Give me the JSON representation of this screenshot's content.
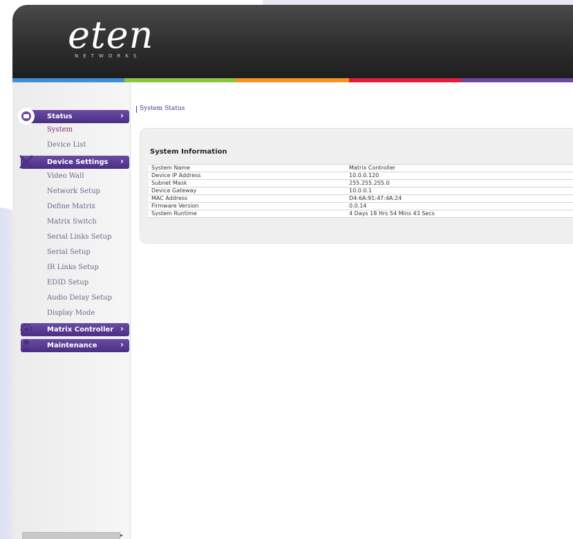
{
  "brand": {
    "logo_text": "eten",
    "logo_sub": "NETWORKS"
  },
  "colorbar": [
    "#3c8fd6",
    "#8dc63f",
    "#f7941d",
    "#e31b3c",
    "#6a4ba3"
  ],
  "sidebar": {
    "sections": [
      {
        "label": "Status",
        "icon": "status-icon",
        "items": [
          {
            "label": "System",
            "active": true
          },
          {
            "label": "Device List",
            "active": false
          }
        ]
      },
      {
        "label": "Device Settings",
        "icon": "tools-icon",
        "items": [
          {
            "label": "Video Wall"
          },
          {
            "label": "Network Setup"
          },
          {
            "label": "Define Matrix"
          },
          {
            "label": "Matrix Switch"
          },
          {
            "label": "Serial Links Setup"
          },
          {
            "label": "Serial Setup"
          },
          {
            "label": "IR Links Setup"
          },
          {
            "label": "EDID Setup"
          },
          {
            "label": "Audio Delay Setup"
          },
          {
            "label": "Display Mode"
          }
        ]
      },
      {
        "label": "Matrix Controller",
        "icon": "gear-icon",
        "items": []
      },
      {
        "label": "Maintenance",
        "icon": "maintenance-icon",
        "items": []
      }
    ],
    "chevron": "›"
  },
  "breadcrumb": "System Status",
  "panel": {
    "title": "System Information",
    "rows": [
      {
        "key": "System Name",
        "value": "Matrix Controller"
      },
      {
        "key": "Device IP Address",
        "value": "10.0.0.120"
      },
      {
        "key": "Subnet Mask",
        "value": "255.255.255.0"
      },
      {
        "key": "Device Gateway",
        "value": "10.0.0.1"
      },
      {
        "key": "MAC Address",
        "value": "D4:6A:91:47:4A:24"
      },
      {
        "key": "Firmware Version",
        "value": "0.0.14"
      },
      {
        "key": "System Runtime",
        "value": "4 Days 18 Hrs 54 Mins 43 Secs"
      }
    ]
  }
}
